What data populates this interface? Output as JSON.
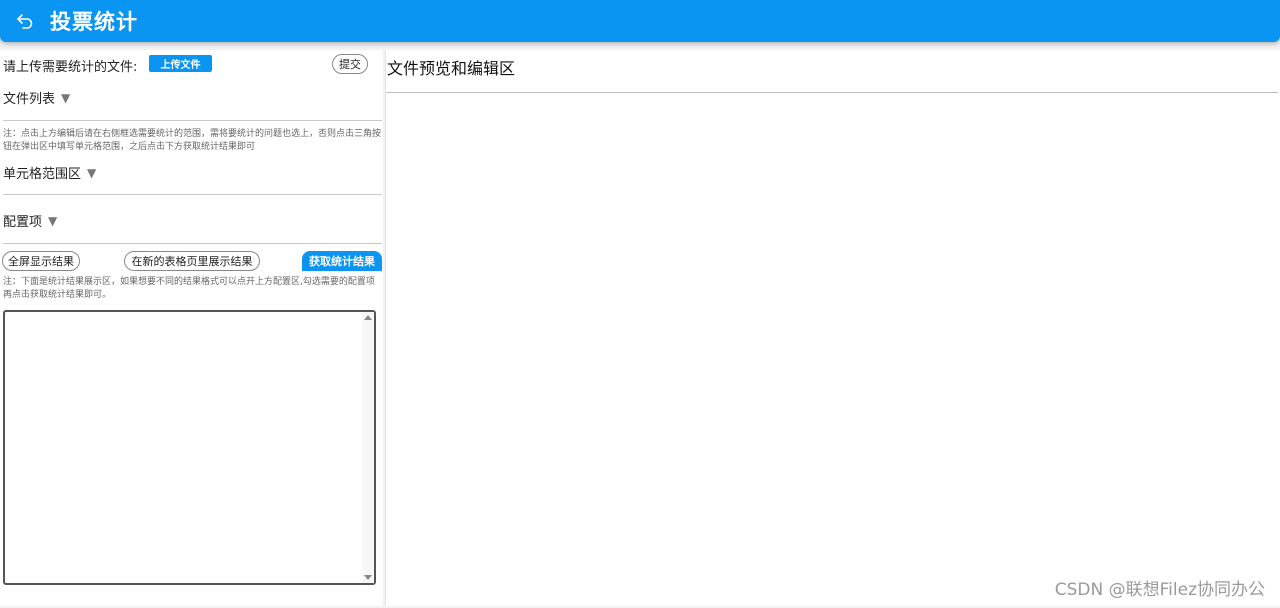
{
  "header": {
    "title": "投票统计",
    "back_icon": "back-arrow-icon",
    "bg_color": "#0b95f2"
  },
  "left": {
    "upload_label": "请上传需要统计的文件:",
    "upload_button": "上传文件",
    "submit_button": "提交",
    "file_list_label": "文件列表",
    "note1": "注：点击上方编辑后请在右侧框选需要统计的范围，需将要统计的问题也选上，否则点击三角按钮在弹出区中填写单元格范围，之后点击下方获取统计结果即可",
    "cell_range_label": "单元格范围区",
    "config_label": "配置项",
    "toggle_icon": "▼",
    "fullscreen_button": "全屏显示结果",
    "new_sheet_button": "在新的表格页里展示结果",
    "get_result_button": "获取统计结果",
    "note2": "注：下面是统计结果展示区，如果想要不同的结果格式可以点开上方配置区,勾选需要的配置项再点击获取统计结果即可。",
    "result_value": ""
  },
  "right": {
    "preview_title": "文件预览和编辑区"
  },
  "watermark": "CSDN @联想Filez协同办公"
}
